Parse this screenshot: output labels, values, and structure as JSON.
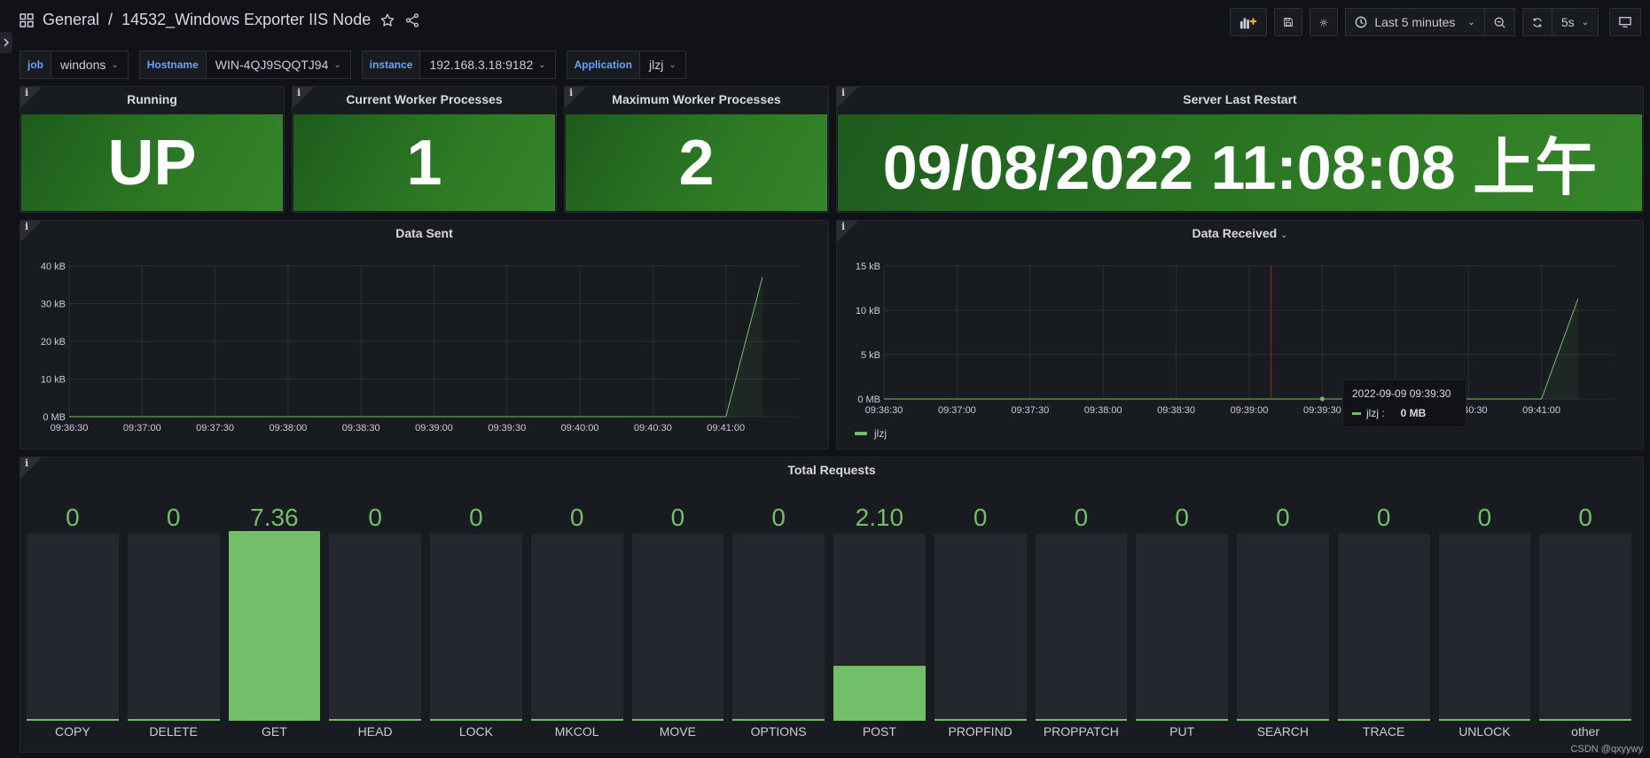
{
  "header": {
    "folder": "General",
    "separator": "/",
    "dashboard_title": "14532_Windows Exporter IIS Node",
    "time_range": "Last 5 minutes",
    "refresh_interval": "5s"
  },
  "variables": [
    {
      "label": "job",
      "value": "windons"
    },
    {
      "label": "Hostname",
      "value": "WIN-4QJ9SQQTJ94"
    },
    {
      "label": "instance",
      "value": "192.168.3.18:9182"
    },
    {
      "label": "Application",
      "value": "jlzj"
    }
  ],
  "stats": [
    {
      "title": "Running",
      "value": "UP"
    },
    {
      "title": "Current Worker Processes",
      "value": "1"
    },
    {
      "title": "Maximum Worker Processes",
      "value": "2"
    },
    {
      "title": "Server Last Restart",
      "value": "09/08/2022 11:08:08 上午"
    }
  ],
  "panel_info_icon": "i",
  "colors": {
    "series": "#73bf69",
    "stat_green": "#2d7a24",
    "accent_blue": "#6e9fff",
    "background": "#111217",
    "panel": "#181b1f"
  },
  "data_sent": {
    "title": "Data Sent",
    "chart_data": {
      "type": "line",
      "x": [
        "09:36:30",
        "09:37:00",
        "09:37:30",
        "09:38:00",
        "09:38:30",
        "09:39:00",
        "09:39:30",
        "09:40:00",
        "09:40:30",
        "09:41:00",
        "09:41:15"
      ],
      "xticks": [
        "09:36:30",
        "09:37:00",
        "09:37:30",
        "09:38:00",
        "09:38:30",
        "09:39:00",
        "09:39:30",
        "09:40:00",
        "09:40:30",
        "09:41:00"
      ],
      "yticks": [
        "0 MB",
        "10 kB",
        "20 kB",
        "30 kB",
        "40 kB"
      ],
      "ylim": [
        0,
        40
      ],
      "series": [
        {
          "values": [
            0,
            0,
            0,
            0,
            0,
            0,
            0,
            0,
            0,
            0,
            37
          ]
        }
      ],
      "grid": true
    }
  },
  "data_received": {
    "title": "Data Received",
    "chart_data": {
      "type": "line",
      "x": [
        "09:36:30",
        "09:37:00",
        "09:37:30",
        "09:38:00",
        "09:38:30",
        "09:39:00",
        "09:39:30",
        "09:40:00",
        "09:40:30",
        "09:41:00",
        "09:41:15"
      ],
      "xticks": [
        "09:36:30",
        "09:37:00",
        "09:37:30",
        "09:38:00",
        "09:38:30",
        "09:39:00",
        "09:39:30",
        "09:40:00",
        "09:40:30",
        "09:41:00"
      ],
      "yticks": [
        "0 MB",
        "5 kB",
        "10 kB",
        "15 kB"
      ],
      "ylim": [
        0,
        15
      ],
      "series": [
        {
          "name": "jlzj",
          "values": [
            0,
            0,
            0,
            0,
            0,
            0,
            0,
            0,
            0,
            0,
            11.3
          ]
        }
      ],
      "grid": true,
      "legend": "bottom-left"
    },
    "tooltip": {
      "time": "2022-09-09 09:39:30",
      "series": "jlzj :",
      "value": "0 MB"
    }
  },
  "total_requests": {
    "title": "Total Requests",
    "chart_data": {
      "type": "bar",
      "categories": [
        "COPY",
        "DELETE",
        "GET",
        "HEAD",
        "LOCK",
        "MKCOL",
        "MOVE",
        "OPTIONS",
        "POST",
        "PROPFIND",
        "PROPPATCH",
        "PUT",
        "SEARCH",
        "TRACE",
        "UNLOCK",
        "other"
      ],
      "labels": [
        "0",
        "0",
        "7.36",
        "0",
        "0",
        "0",
        "0",
        "0",
        "2.10",
        "0",
        "0",
        "0",
        "0",
        "0",
        "0",
        "0"
      ],
      "values": [
        0,
        0,
        7.36,
        0,
        0,
        0,
        0,
        0,
        2.1,
        0,
        0,
        0,
        0,
        0,
        0,
        0
      ],
      "ylim": [
        0,
        7.36
      ]
    }
  },
  "watermark": "CSDN @qxyywy"
}
